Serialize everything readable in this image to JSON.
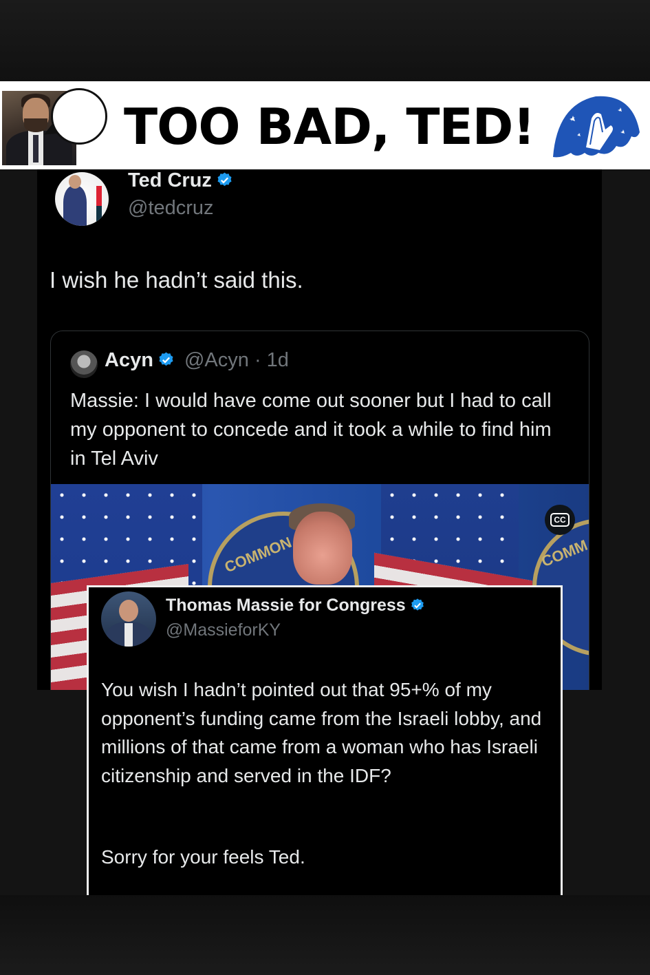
{
  "banner": {
    "title": "TOO BAD, TED!"
  },
  "main_tweet": {
    "author_name": "Ted Cruz",
    "author_handle": "@tedcruz",
    "text": "I wish he hadn’t said this.",
    "verified": true
  },
  "quoted_tweet": {
    "author_name": "Acyn",
    "author_handle": "@Acyn",
    "age": "· 1d",
    "text": "Massie: I would have come out sooner but I had to call my opponent to concede and it took a while to find him in Tel Aviv",
    "media": {
      "seal_text_left": "COMMON",
      "seal_text_right": "COMM",
      "captions_button": "CC"
    }
  },
  "reply_tweet": {
    "author_name": "Thomas Massie for Congress",
    "author_handle": "@MassieforKY",
    "text": "You wish I hadn’t pointed out that 95+% of my opponent’s funding came from the Israeli lobby, and millions of that came from a woman who has Israeli citizenship and served in the IDF?",
    "text2": "Sorry for your feels Ted."
  },
  "colors": {
    "verified_badge": "#1d9bf0",
    "logo_blue": "#1f55b7",
    "tweet_bg": "#000000",
    "text_primary": "#e7e9ea",
    "text_secondary": "#71767b"
  },
  "icons": [
    "verified-badge-icon",
    "praying-hands-logo-icon",
    "closed-captions-icon"
  ]
}
